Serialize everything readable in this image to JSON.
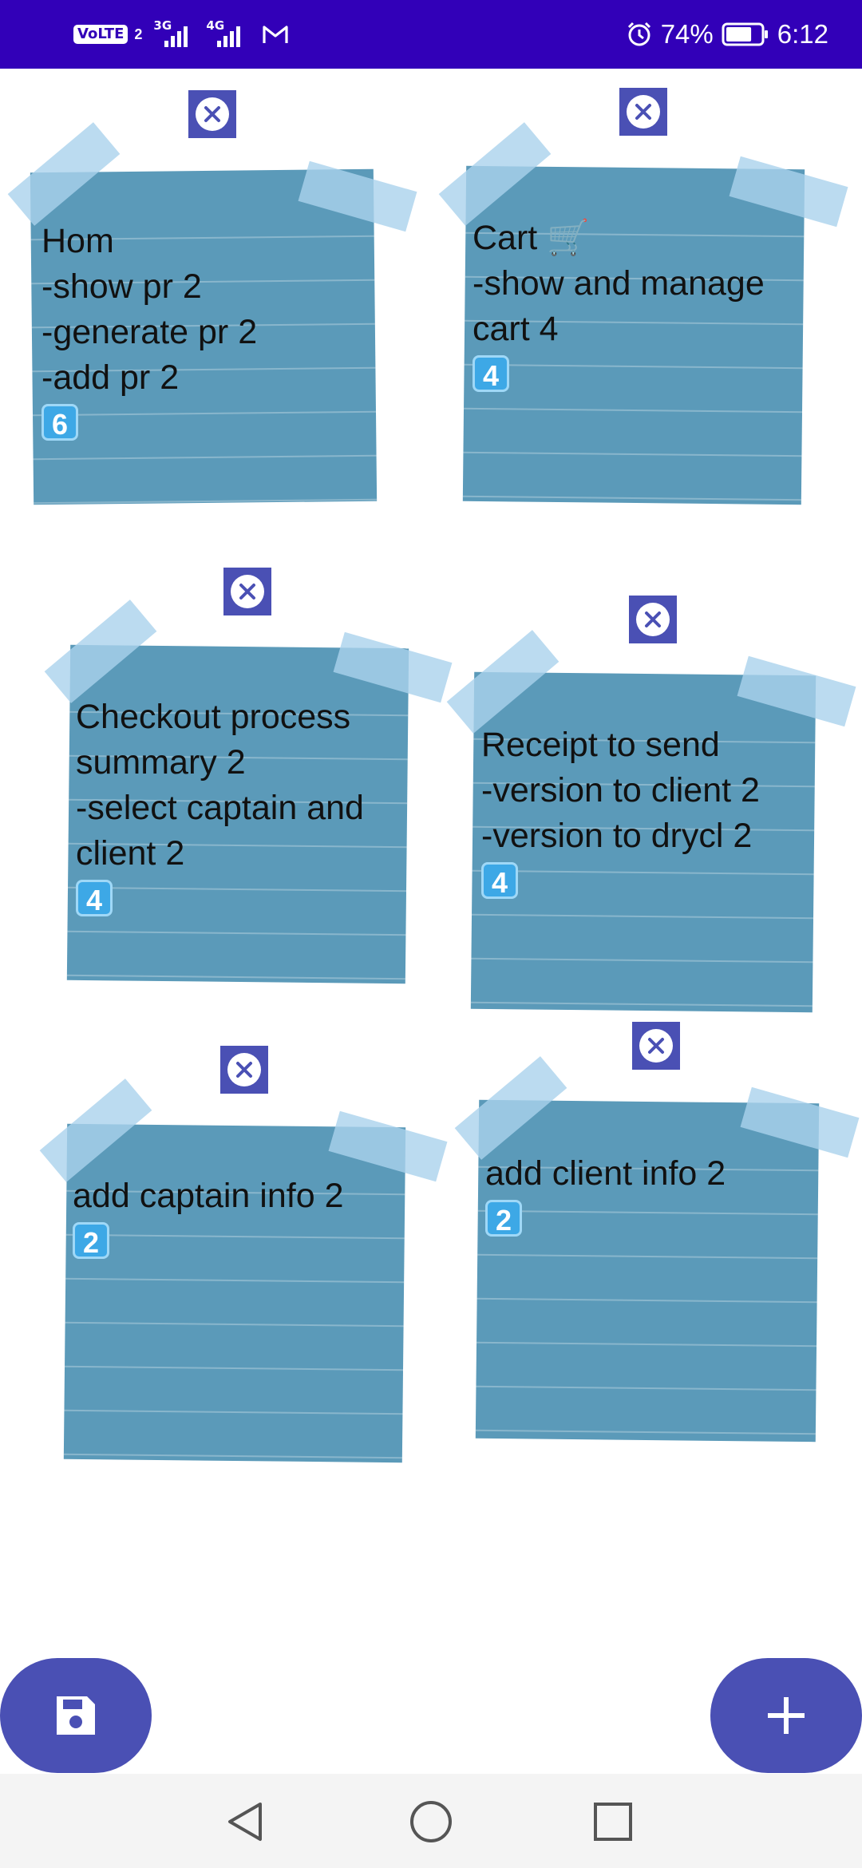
{
  "status_bar": {
    "volte": "VoLTE",
    "sim": "2",
    "net1": "3G",
    "net2": "4G",
    "battery": "74%",
    "time": "6:12",
    "battery_level": 0.74
  },
  "notes": [
    {
      "id": "home",
      "lines": [
        "Hom",
        "-show pr 2",
        "-generate pr 2",
        "-add pr 2"
      ],
      "badge": "6"
    },
    {
      "id": "cart",
      "lines": [
        "Cart 🛒",
        "-show and manage cart 4"
      ],
      "badge": "4"
    },
    {
      "id": "checkout",
      "lines": [
        "Checkout process summary 2",
        "-select captain and client 2"
      ],
      "badge": "4"
    },
    {
      "id": "receipt",
      "lines": [
        "Receipt to send",
        "-version to client 2",
        "-version to drycl 2"
      ],
      "badge": "4"
    },
    {
      "id": "captain",
      "lines": [
        "add captain info 2"
      ],
      "badge": "2"
    },
    {
      "id": "client",
      "lines": [
        "add client info 2"
      ],
      "badge": "2"
    }
  ],
  "icons": {
    "close": "close-icon",
    "save": "save-icon",
    "add": "plus-icon",
    "back": "back-icon",
    "home": "home-icon",
    "recents": "recents-icon"
  },
  "colors": {
    "status_bar": "#3200b8",
    "accent": "#4a50b4",
    "note": "#5b9ab9",
    "tape": "#aad2ec"
  }
}
